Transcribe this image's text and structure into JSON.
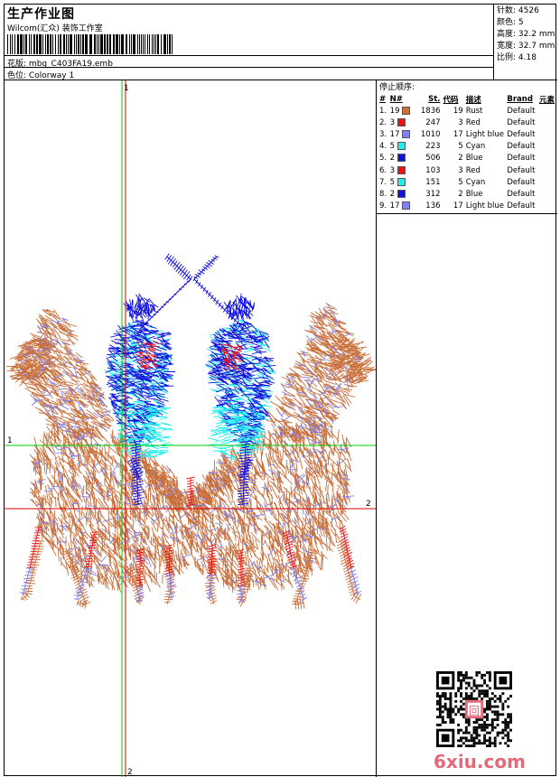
{
  "header": {
    "title": "生产作业图",
    "company": "Wilcom(汇众) 装饰工作室",
    "design_label": "花版:",
    "design_value": "mbg_C403FA19.emb",
    "colorway_label": "色位:",
    "colorway_value": "Colorway 1"
  },
  "stats": [
    {
      "label": "针数:",
      "value": "4526"
    },
    {
      "label": "颜色:",
      "value": "5"
    },
    {
      "label": "高度:",
      "value": "32.2 mm"
    },
    {
      "label": "宽度:",
      "value": "32.7 mm"
    },
    {
      "label": "比例:",
      "value": "4.18"
    }
  ],
  "sequence": {
    "title": "停止顺序:",
    "headers": [
      "#",
      "N#",
      "St.",
      "代码",
      "描述",
      "Brand",
      "元素"
    ],
    "rows": [
      {
        "idx": "1.",
        "n": "19",
        "color": "#c86f3a",
        "st": "1836",
        "code": "19",
        "desc": "Rust",
        "brand": "Default"
      },
      {
        "idx": "2.",
        "n": "3",
        "color": "#ee1111",
        "st": "247",
        "code": "3",
        "desc": "Red",
        "brand": "Default"
      },
      {
        "idx": "3.",
        "n": "17",
        "color": "#8080ee",
        "st": "1010",
        "code": "17",
        "desc": "Light blue",
        "brand": "Default"
      },
      {
        "idx": "4.",
        "n": "5",
        "color": "#22eeee",
        "st": "223",
        "code": "5",
        "desc": "Cyan",
        "brand": "Default"
      },
      {
        "idx": "5.",
        "n": "2",
        "color": "#1111dd",
        "st": "506",
        "code": "2",
        "desc": "Blue",
        "brand": "Default"
      },
      {
        "idx": "6.",
        "n": "3",
        "color": "#ee1111",
        "st": "103",
        "code": "3",
        "desc": "Red",
        "brand": "Default"
      },
      {
        "idx": "7.",
        "n": "5",
        "color": "#22eeee",
        "st": "151",
        "code": "5",
        "desc": "Cyan",
        "brand": "Default"
      },
      {
        "idx": "8.",
        "n": "2",
        "color": "#1111dd",
        "st": "312",
        "code": "2",
        "desc": "Blue",
        "brand": "Default"
      },
      {
        "idx": "9.",
        "n": "17",
        "color": "#8080ee",
        "st": "136",
        "code": "17",
        "desc": "Light blue",
        "brand": "Default"
      }
    ]
  },
  "guides": {
    "v1_label": "1",
    "v2_label": "2",
    "h1_label": "1",
    "h2_label": "2"
  },
  "watermark": "6xiu.com",
  "qr_stamp": "回"
}
